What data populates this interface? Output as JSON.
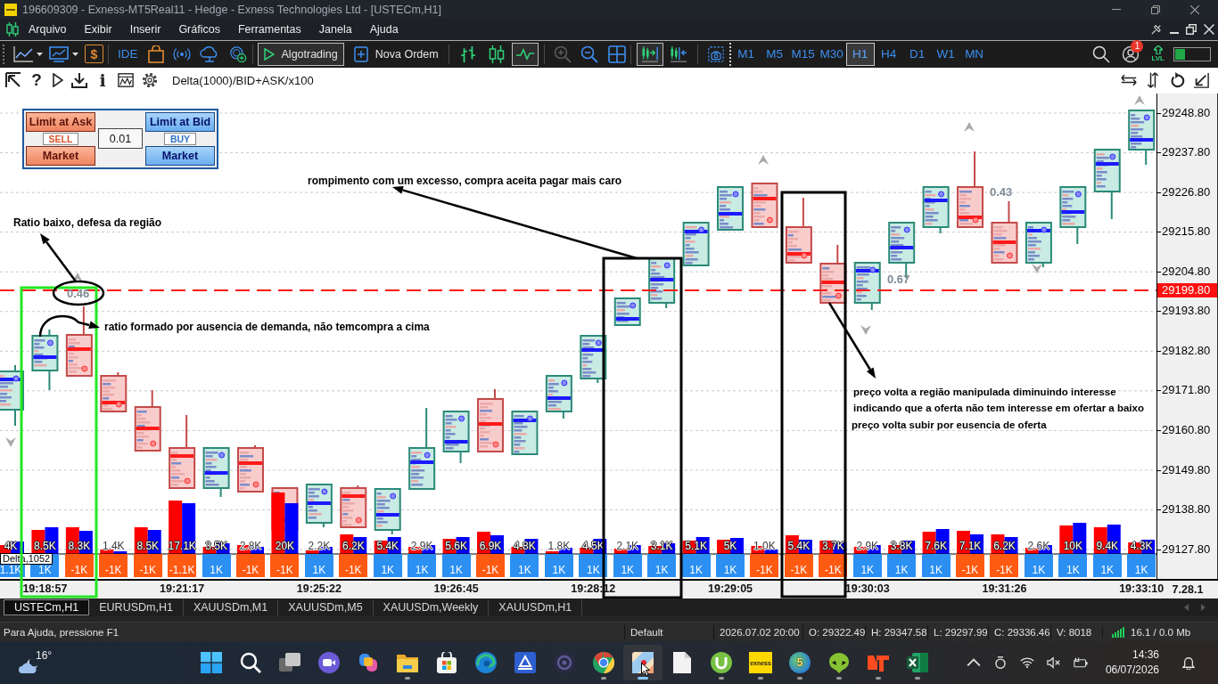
{
  "window": {
    "title": "196609309 - Exness-MT5Real11 - Hedge - Exness Technologies Ltd - [USTECm,H1]"
  },
  "menu": [
    "Arquivo",
    "Exibir",
    "Inserir",
    "Gráficos",
    "Ferramentas",
    "Janela",
    "Ajuda"
  ],
  "toolbar": {
    "account_symbol": "$",
    "ide": "IDE",
    "algotrading": {
      "label": "Algotrading",
      "on": true
    },
    "new_order": "Nova Ordem",
    "chart_types": [
      {
        "kind": "bars",
        "selected": false
      },
      {
        "kind": "candles",
        "selected": false
      },
      {
        "kind": "line",
        "selected": true
      }
    ],
    "zoom": [
      {
        "kind": "zoom-in",
        "disabled": true
      },
      {
        "kind": "zoom-out",
        "disabled": false
      }
    ],
    "scroll_modes": [
      {
        "kind": "chart-shift",
        "on": true
      },
      {
        "kind": "auto-scroll",
        "on": false
      }
    ],
    "timeframes": [
      {
        "label": "M1",
        "selected": false
      },
      {
        "label": "M5",
        "selected": false
      },
      {
        "label": "M15",
        "selected": false
      },
      {
        "label": "M30",
        "selected": false
      },
      {
        "label": "H1",
        "selected": true
      },
      {
        "label": "H4",
        "selected": false
      },
      {
        "label": "D1",
        "selected": false
      },
      {
        "label": "W1",
        "selected": false
      },
      {
        "label": "MN",
        "selected": false
      }
    ],
    "notifications": "1",
    "level_badge": "LVL"
  },
  "chart": {
    "toolbar": {
      "help_glyph": "?",
      "info_glyph": "i",
      "indicator": "Delta(1000)/BID+ASK/x100"
    },
    "trade_panel": {
      "sell": {
        "limit": "Limit at Ask",
        "side": "SELL",
        "market": "Market"
      },
      "lot": "0.01",
      "buy": {
        "limit": "Limit at Bid",
        "side": "BUY",
        "market": "Market"
      }
    },
    "annotations": [
      {
        "text": "Ratio baixo, defesa da região"
      },
      {
        "text": "ratio formado por ausencia de demanda, não temcompra a cima"
      },
      {
        "text": "rompimento com um excesso, compra aceita pagar mais caro"
      },
      {
        "text": "preço volta a região manipulada diminuindo interesse"
      },
      {
        "text": "indicando que a oferta não tem interesse em ofertar a baixo"
      },
      {
        "text": "preço volta subir por eusencia de oferta"
      }
    ],
    "ratio_labels": [
      "0.46",
      "0.67",
      "0.43"
    ],
    "price_axis": {
      "ticks": [
        "29248.80",
        "29237.80",
        "29226.80",
        "29215.80",
        "29204.80",
        "29193.80",
        "29182.80",
        "29171.80",
        "29160.80",
        "29149.80",
        "29138.80",
        "29127.80"
      ],
      "current_price": "29199.80"
    },
    "volume_columns": [
      {
        "volume": "4K",
        "delta": "1.1K",
        "kind": "positive"
      },
      {
        "volume": "8.5K",
        "delta": "1K",
        "kind": "positive"
      },
      {
        "volume": "8.3K",
        "delta": "-1K",
        "kind": "negative"
      },
      {
        "volume": "1.4K",
        "delta": "-1K",
        "kind": "negative"
      },
      {
        "volume": "8.5K",
        "delta": "-1K",
        "kind": "negative"
      },
      {
        "volume": "17.1K",
        "delta": "-1.1K",
        "kind": "negative"
      },
      {
        "volume": "3.5K",
        "delta": "1K",
        "kind": "positive"
      },
      {
        "volume": "2.8K",
        "delta": "-1K",
        "kind": "negative"
      },
      {
        "volume": "20K",
        "delta": "-1K",
        "kind": "negative"
      },
      {
        "volume": "2.2K",
        "delta": "1K",
        "kind": "positive"
      },
      {
        "volume": "6.2K",
        "delta": "-1K",
        "kind": "negative"
      },
      {
        "volume": "5.4K",
        "delta": "1K",
        "kind": "positive"
      },
      {
        "volume": "2.9K",
        "delta": "1K",
        "kind": "positive"
      },
      {
        "volume": "5.6K",
        "delta": "1K",
        "kind": "positive"
      },
      {
        "volume": "6.9K",
        "delta": "-1K",
        "kind": "negative"
      },
      {
        "volume": "4.8K",
        "delta": "1K",
        "kind": "positive"
      },
      {
        "volume": "1.8K",
        "delta": "1K",
        "kind": "positive"
      },
      {
        "volume": "4.5K",
        "delta": "1K",
        "kind": "positive"
      },
      {
        "volume": "2.1K",
        "delta": "1K",
        "kind": "positive"
      },
      {
        "volume": "3.1K",
        "delta": "1K",
        "kind": "positive"
      },
      {
        "volume": "5.1K",
        "delta": "1K",
        "kind": "positive"
      },
      {
        "volume": "5K",
        "delta": "1K",
        "kind": "positive"
      },
      {
        "volume": "1.0K",
        "delta": "-1K",
        "kind": "negative"
      },
      {
        "volume": "5.4K",
        "delta": "-1K",
        "kind": "negative"
      },
      {
        "volume": "3.7K",
        "delta": "-1K",
        "kind": "negative"
      },
      {
        "volume": "2.9K",
        "delta": "1K",
        "kind": "positive"
      },
      {
        "volume": "3.8K",
        "delta": "1K",
        "kind": "positive"
      },
      {
        "volume": "7.6K",
        "delta": "1K",
        "kind": "positive"
      },
      {
        "volume": "7.1K",
        "delta": "-1K",
        "kind": "negative"
      },
      {
        "volume": "6.2K",
        "delta": "-1K",
        "kind": "negative"
      },
      {
        "volume": "2.6K",
        "delta": "1K",
        "kind": "positive"
      },
      {
        "volume": "10K",
        "delta": "1K",
        "kind": "positive"
      },
      {
        "volume": "9.4K",
        "delta": "1K",
        "kind": "positive"
      },
      {
        "volume": "4.3K",
        "delta": "1K",
        "kind": "positive"
      }
    ],
    "delta_label": "Delta,1052",
    "time_axis": [
      "19:18:57",
      "19:21:17",
      "19:25:22",
      "19:26:45",
      "19:28:12",
      "19:29:05",
      "19:30:03",
      "19:31:26",
      "19:33:10"
    ],
    "axis_corner": "7.28.1"
  },
  "chart_tabs": [
    {
      "label": "USTECm,H1",
      "selected": true
    },
    {
      "label": "EURUSDm,H1",
      "selected": false
    },
    {
      "label": "XAUUSDm,M1",
      "selected": false
    },
    {
      "label": "XAUUSDm,M5",
      "selected": false
    },
    {
      "label": "XAUUSDm,Weekly",
      "selected": false
    },
    {
      "label": "XAUUSDm,H1",
      "selected": false
    }
  ],
  "status_bar": {
    "help": "Para Ajuda, pressione F1",
    "profile": "Default",
    "datetime": "2026.07.02 20:00",
    "open": "O: 29322.49",
    "high": "H: 29347.58",
    "low": "L: 29297.99",
    "close": "C: 29336.46",
    "volume": "V: 8018",
    "traffic": "16.1 / 0.0 Mb"
  },
  "taskbar": {
    "weather": "16°",
    "apps": [
      {
        "kind": "start",
        "running": false,
        "active": false
      },
      {
        "kind": "search",
        "running": false,
        "active": false
      },
      {
        "kind": "task-view",
        "running": false,
        "active": false
      },
      {
        "kind": "meet",
        "running": false,
        "active": false
      },
      {
        "kind": "copilot",
        "running": false,
        "active": false
      },
      {
        "kind": "explorer",
        "running": true,
        "active": false
      },
      {
        "kind": "store",
        "running": false,
        "active": false
      },
      {
        "kind": "edge",
        "running": false,
        "active": false
      },
      {
        "kind": "scanner",
        "running": false,
        "active": false
      },
      {
        "kind": "recorder",
        "running": false,
        "active": false
      },
      {
        "kind": "chrome",
        "running": true,
        "active": false
      },
      {
        "kind": "paint",
        "running": true,
        "active": true
      },
      {
        "kind": "file",
        "running": false,
        "active": false
      },
      {
        "kind": "torrent",
        "running": true,
        "active": false
      },
      {
        "kind": "tile",
        "label": "exness",
        "running": true,
        "active": false
      },
      {
        "kind": "ball",
        "label": "5",
        "running": true,
        "active": false
      },
      {
        "kind": "alien",
        "running": true,
        "active": false
      },
      {
        "kind": "angular",
        "running": true,
        "active": false
      },
      {
        "kind": "sheet",
        "running": true,
        "active": false
      }
    ],
    "time": "14:36",
    "date": "06/07/2026"
  }
}
